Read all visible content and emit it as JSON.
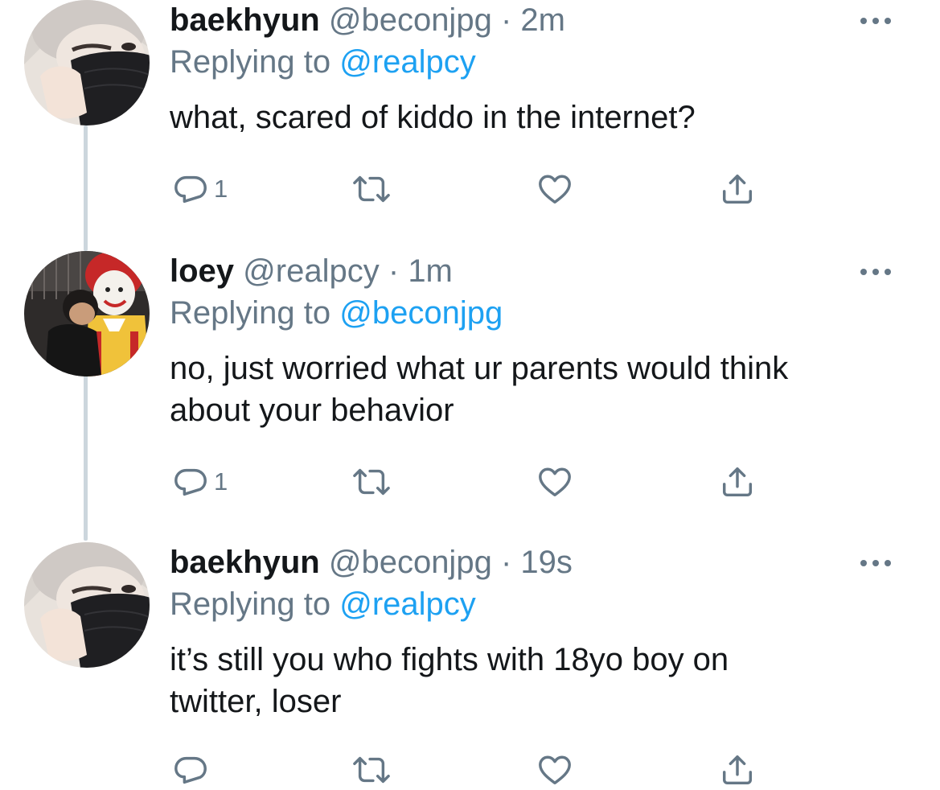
{
  "tweets": [
    {
      "name": "baekhyun",
      "handle": "@beconjpg",
      "separator": "·",
      "time": "2m",
      "replying_prefix": "Replying to",
      "replying_handle": "@realpcy",
      "lines": [
        "what, scared of kiddo in the internet?"
      ],
      "reply_count": "1",
      "avatar": "baekhyun-avatar"
    },
    {
      "name": "loey",
      "handle": "@realpcy",
      "separator": "·",
      "time": "1m",
      "replying_prefix": "Replying to",
      "replying_handle": "@beconjpg",
      "lines": [
        "no, just worried what ur parents would think",
        "about your behavior"
      ],
      "reply_count": "1",
      "avatar": "loey-avatar"
    },
    {
      "name": "baekhyun",
      "handle": "@beconjpg",
      "separator": "·",
      "time": "19s",
      "replying_prefix": "Replying to",
      "replying_handle": "@realpcy",
      "lines": [
        "it’s still you who fights with 18yo boy on",
        "twitter, loser"
      ],
      "reply_count": "",
      "avatar": "baekhyun-avatar"
    }
  ],
  "colors": {
    "text": "#14171a",
    "secondary": "#657786",
    "link": "#1da1f2",
    "thread_line": "#ccd6dd"
  },
  "icons": [
    "reply-icon",
    "retweet-icon",
    "like-icon",
    "share-icon",
    "more-icon"
  ]
}
